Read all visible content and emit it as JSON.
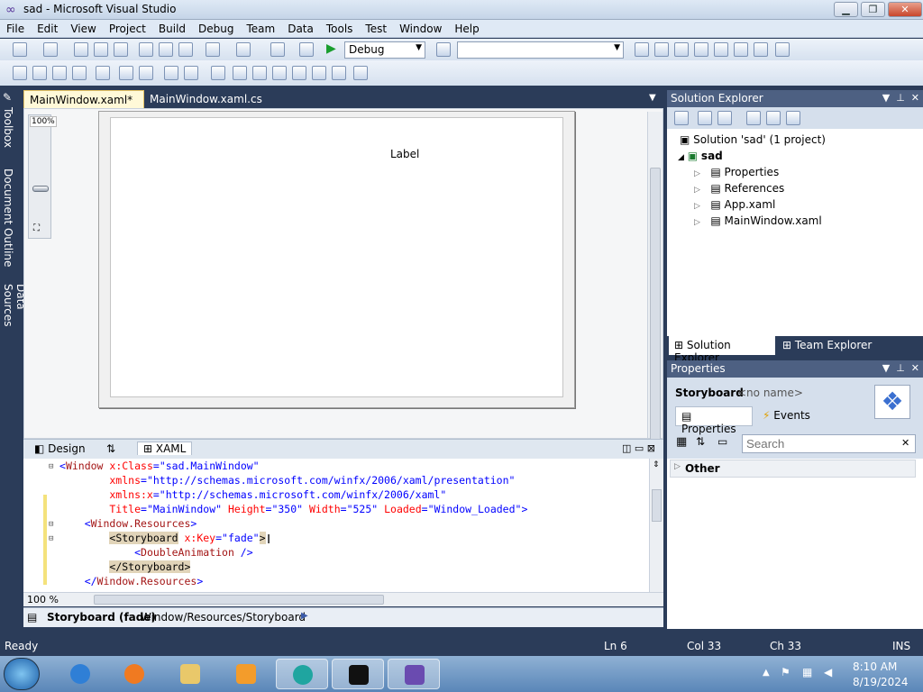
{
  "window": {
    "title": "sad - Microsoft Visual Studio"
  },
  "menu": [
    "File",
    "Edit",
    "View",
    "Project",
    "Build",
    "Debug",
    "Team",
    "Data",
    "Tools",
    "Test",
    "Window",
    "Help"
  ],
  "toolbar": {
    "config": "Debug",
    "platform": ""
  },
  "side_tabs": [
    "Toolbox",
    "Document Outline",
    "Data Sources"
  ],
  "doc_tabs": [
    {
      "label": "MainWindow.xaml*",
      "close": "✕"
    },
    {
      "label": "MainWindow.xaml.cs"
    }
  ],
  "designer": {
    "zoom_label": "100%",
    "window_label": "Label"
  },
  "split_tabs": {
    "design": "Design",
    "swap": "⇅",
    "xaml": "XAML"
  },
  "code_lines": [
    {
      "parts": [
        [
          "bl",
          "<"
        ],
        [
          "kw",
          "Window"
        ],
        [
          "at",
          " x:Class"
        ],
        [
          "bl",
          "="
        ],
        [
          "st",
          "\"sad.MainWindow\""
        ]
      ]
    },
    {
      "parts": [
        [
          "at",
          "        xmlns"
        ],
        [
          "bl",
          "="
        ],
        [
          "st",
          "\"http://schemas.microsoft.com/winfx/2006/xaml/presentation\""
        ]
      ]
    },
    {
      "parts": [
        [
          "at",
          "        xmlns:x"
        ],
        [
          "bl",
          "="
        ],
        [
          "st",
          "\"http://schemas.microsoft.com/winfx/2006/xaml\""
        ]
      ]
    },
    {
      "parts": [
        [
          "at",
          "        Title"
        ],
        [
          "bl",
          "="
        ],
        [
          "st",
          "\"MainWindow\""
        ],
        [
          "at",
          " Height"
        ],
        [
          "bl",
          "="
        ],
        [
          "st",
          "\"350\""
        ],
        [
          "at",
          " Width"
        ],
        [
          "bl",
          "="
        ],
        [
          "st",
          "\"525\""
        ],
        [
          "at",
          " Loaded"
        ],
        [
          "bl",
          "="
        ],
        [
          "st",
          "\"Window_Loaded\""
        ],
        [
          "bl",
          ">"
        ]
      ]
    },
    {
      "parts": [
        [
          "bl",
          "    <"
        ],
        [
          "kw",
          "Window.Resources"
        ],
        [
          "bl",
          ">"
        ]
      ]
    },
    {
      "parts": [
        [
          "bl",
          "        "
        ],
        [
          "hl",
          "<Storyboard"
        ],
        [
          "at",
          " x:Key"
        ],
        [
          "bl",
          "="
        ],
        [
          "st",
          "\"fade\""
        ],
        [
          "hl",
          ">"
        ]
      ]
    },
    {
      "parts": [
        [
          "bl",
          "            <"
        ],
        [
          "kw",
          "DoubleAnimation"
        ],
        [
          "bl",
          " />"
        ]
      ]
    },
    {
      "parts": [
        [
          "bl",
          "        "
        ],
        [
          "hl",
          "</Storyboard>"
        ]
      ]
    },
    {
      "parts": [
        [
          "bl",
          "    </"
        ],
        [
          "kw",
          "Window.Resources"
        ],
        [
          "bl",
          ">"
        ]
      ]
    }
  ],
  "code_zoom": "100 %",
  "breadcrumb": {
    "bold": "Storyboard (fade)",
    "path": "Window/Resources/Storyboard"
  },
  "solution_explorer": {
    "title": "Solution Explorer",
    "solution": "Solution 'sad' (1 project)",
    "project": "sad",
    "items": [
      "Properties",
      "References",
      "App.xaml",
      "MainWindow.xaml"
    ],
    "tabs": [
      "Solution Explorer",
      "Team Explorer"
    ]
  },
  "properties": {
    "title": "Properties",
    "object": "Storyboard",
    "name": "<no name>",
    "tabs": [
      "Properties",
      "Events"
    ],
    "search_placeholder": "Search",
    "category": "Other"
  },
  "status": {
    "left": "Ready",
    "ln": "Ln 6",
    "col": "Col 33",
    "ch": "Ch 33",
    "mode": "INS"
  },
  "clock": {
    "time": "8:10 AM",
    "date": "8/19/2024"
  }
}
